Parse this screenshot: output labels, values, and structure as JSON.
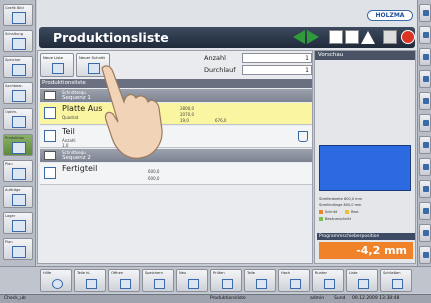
{
  "left_sidebar": [
    {
      "label": "Grafik Bild",
      "active": false
    },
    {
      "label": "Schaltung",
      "active": false
    },
    {
      "label": "Speicher",
      "active": false
    },
    {
      "label": "Sachbear.",
      "active": false
    },
    {
      "label": "Optim.",
      "active": false
    },
    {
      "label": "Produktion",
      "active": true
    },
    {
      "label": "Plan",
      "active": false
    },
    {
      "label": "Aufträge",
      "active": false
    },
    {
      "label": "Lager",
      "active": false
    },
    {
      "label": "Plan",
      "active": false
    }
  ],
  "header": {
    "brand": "HOLZMA",
    "title": "Produktionsliste"
  },
  "toolbar": {
    "button1": "Neue Liste",
    "button2": "Neuer Schnitt"
  },
  "form": {
    "anzahl_label": "Anzahl",
    "anzahl_value": "1",
    "durchlauf_label": "Durchlauf",
    "durchlauf_value": "1"
  },
  "list": {
    "header": "Produktionsliste",
    "sequence1_a": "Schnittsequ.",
    "sequence1_b": "Sequenz 1",
    "row1_name": "Platte Aus",
    "row1_sub": "Quadrat",
    "row1_v1": "2800,0",
    "row1_v2": "2070,0",
    "row1_v3": "19,0",
    "row1_v4": "676,0",
    "row2_name": "Teil",
    "row2_sub": "Anzahl",
    "row2_v1": "1,0",
    "sequence2_a": "Schnittsequ.",
    "sequence2_b": "Sequenz 2",
    "row3_name": "Fertigteil",
    "row3_v1": "600,0",
    "row3_v2": "600,0"
  },
  "preview": {
    "title": "Vorschau",
    "legend1": "Streifenbreite 800,0 mm",
    "legend2": "Streifenlänge 800,0 mm",
    "legend3": "Schnitt",
    "legend4": "Rest",
    "legend5": "Besäumschnitt",
    "position_label": "Programmschieberposition",
    "position_value": "-4,2 mm"
  },
  "bottom_bar": [
    "Hilfe",
    "Teile hi.",
    "Öffnen",
    "Speichern",
    "Neu",
    "Prüfen",
    "Teile",
    "Hoch",
    "Runter",
    "Liste",
    "Schließen"
  ],
  "status": {
    "user": "Check_ub",
    "view": "Produktionsliste",
    "account": "admin",
    "mode": "Sund",
    "datetime": "09.12.2009 13:38:48"
  },
  "colors": {
    "title_bg": "#1f2a3a",
    "accent_green": "#2f9a3a",
    "selected_row": "#faf5a0",
    "preview_blue": "#2b6ae0",
    "position_orange": "#f0822a"
  }
}
